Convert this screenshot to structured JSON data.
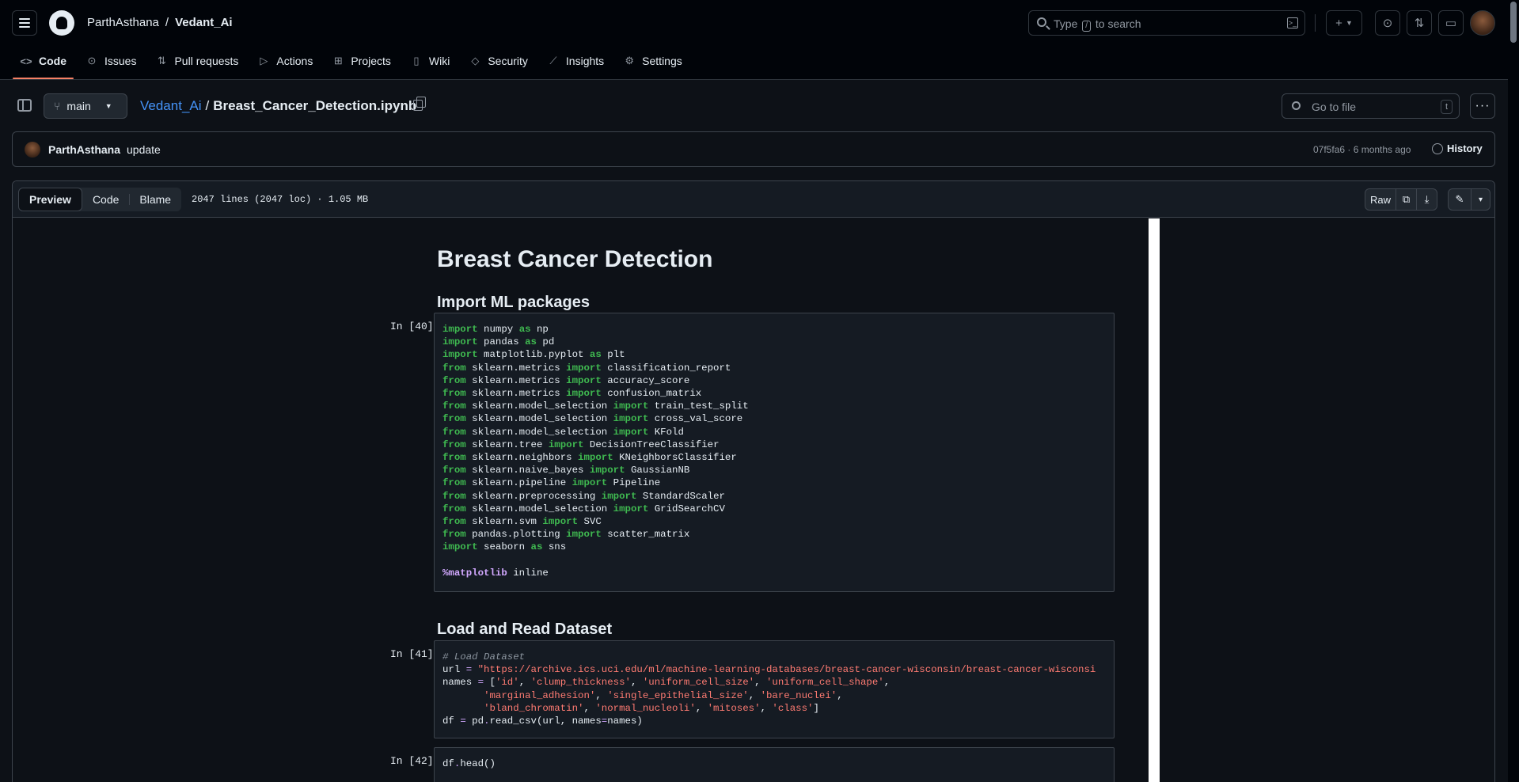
{
  "header": {
    "owner": "ParthAsthana",
    "separator": "/",
    "repo": "Vedant_Ai",
    "search_prefix": "Type",
    "search_key": "/",
    "search_suffix": "to search",
    "new_label": "+",
    "icons": [
      "menu-icon",
      "github-logo-icon",
      "search-icon",
      "command-palette-icon",
      "plus-icon",
      "issue-icon",
      "pull-request-icon",
      "inbox-icon",
      "avatar"
    ]
  },
  "repo_tabs": [
    {
      "label": "Code",
      "icon": "code-icon",
      "active": true
    },
    {
      "label": "Issues",
      "icon": "issue-icon"
    },
    {
      "label": "Pull requests",
      "icon": "pull-request-icon"
    },
    {
      "label": "Actions",
      "icon": "play-icon"
    },
    {
      "label": "Projects",
      "icon": "table-icon"
    },
    {
      "label": "Wiki",
      "icon": "book-icon"
    },
    {
      "label": "Security",
      "icon": "shield-icon"
    },
    {
      "label": "Insights",
      "icon": "graph-icon"
    },
    {
      "label": "Settings",
      "icon": "gear-icon"
    }
  ],
  "file_header": {
    "branch": "main",
    "repo_link": "Vedant_Ai",
    "path_sep": "/",
    "file_name": "Breast_Cancer_Detection.ipynb",
    "go_to_file_placeholder": "Go to file",
    "go_to_file_key": "t",
    "more_label": "···"
  },
  "commit": {
    "author": "ParthAsthana",
    "message": "update",
    "meta": "07f5fa6 · 6 months ago",
    "history_label": "History"
  },
  "file_toolbar": {
    "tabs": [
      "Preview",
      "Code",
      "Blame"
    ],
    "active_tab": "Preview",
    "info": "2047 lines (2047 loc) · 1.05 MB",
    "raw_label": "Raw",
    "copy_icon": "copy-icon",
    "download_icon": "download-icon",
    "edit_icon": "pencil-icon",
    "caret": "▾"
  },
  "notebook": {
    "title": "Breast Cancer Detection",
    "section1": "Import ML packages",
    "prompt1": "In [40]:",
    "section2": "Load and Read Dataset",
    "prompt2": "In [41]:",
    "prompt3": "In [42]:",
    "cell1_lines": [
      "import numpy as np",
      "import pandas as pd",
      "import matplotlib.pyplot as plt",
      "from sklearn.metrics import classification_report",
      "from sklearn.metrics import accuracy_score",
      "from sklearn.metrics import confusion_matrix",
      "from sklearn.model_selection import train_test_split",
      "from sklearn.model_selection import cross_val_score",
      "from sklearn.model_selection import KFold",
      "from sklearn.tree import DecisionTreeClassifier",
      "from sklearn.neighbors import KNeighborsClassifier",
      "from sklearn.naive_bayes import GaussianNB",
      "from sklearn.pipeline import Pipeline",
      "from sklearn.preprocessing import StandardScaler",
      "from sklearn.model_selection import GridSearchCV",
      "from sklearn.svm import SVC",
      "from pandas.plotting import scatter_matrix",
      "import seaborn as sns",
      "",
      "%matplotlib inline"
    ],
    "cell2_lines": [
      "# Load Dataset",
      "url = \"https://archive.ics.uci.edu/ml/machine-learning-databases/breast-cancer-wisconsin/breast-cancer-wisconsi",
      "names = ['id', 'clump_thickness', 'uniform_cell_size', 'uniform_cell_shape',",
      "       'marginal_adhesion', 'single_epithelial_size', 'bare_nuclei',",
      "       'bland_chromatin', 'normal_nucleoli', 'mitoses', 'class']",
      "df = pd.read_csv(url, names=names)"
    ],
    "cell3_lines": [
      "df.head()"
    ]
  }
}
